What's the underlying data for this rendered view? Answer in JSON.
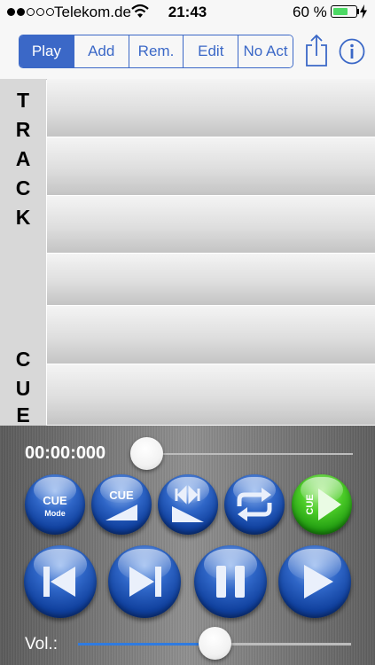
{
  "status_bar": {
    "carrier": "Telekom.de",
    "time": "21:43",
    "battery_percent": "60 %",
    "battery_level": 0.6,
    "signal_dots": 5,
    "signal_filled": 2
  },
  "toolbar": {
    "segments": [
      "Play",
      "Add",
      "Rem.",
      "Edit",
      "No Act"
    ],
    "selected": "Play",
    "share_icon": "share-icon",
    "info_icon": "info-icon"
  },
  "sidebar": {
    "track_letters": [
      "T",
      "R",
      "A",
      "C",
      "K"
    ],
    "cue_letters": [
      "C",
      "U",
      "E"
    ]
  },
  "list": {
    "row_count": 6
  },
  "player": {
    "timecode": "00:00:000",
    "position": 0,
    "volume": 0.5,
    "volume_label": "Vol.:",
    "cue_mode_label": "CUE",
    "cue_mode_sub": "Mode",
    "cue_label": "CUE",
    "accent_blue": "#2f66c7",
    "accent_green": "#4ccc28"
  }
}
